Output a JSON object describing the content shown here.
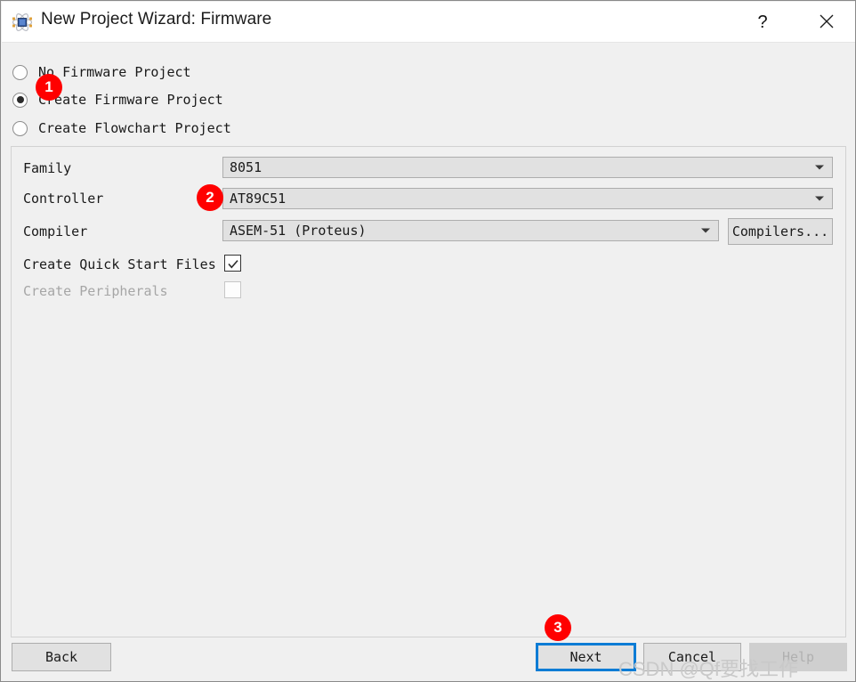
{
  "window": {
    "title": "New Project Wizard: Firmware",
    "icon": "atom-icon",
    "help_button": "?",
    "close_button": "✕"
  },
  "project_type": {
    "options": [
      {
        "label": "No Firmware Project",
        "selected": false
      },
      {
        "label": "Create Firmware Project",
        "selected": true
      },
      {
        "label": "Create Flowchart Project",
        "selected": false
      }
    ]
  },
  "form": {
    "family": {
      "label": "Family",
      "value": "8051"
    },
    "controller": {
      "label": "Controller",
      "value": "AT89C51"
    },
    "compiler": {
      "label": "Compiler",
      "value": "ASEM-51 (Proteus)"
    },
    "compilers_button": "Compilers...",
    "quick_start": {
      "label": "Create Quick Start Files",
      "checked": true
    },
    "peripherals": {
      "label": "Create Peripherals",
      "checked": false,
      "disabled": true
    }
  },
  "footer": {
    "back": "Back",
    "next": "Next",
    "cancel": "Cancel",
    "help": "Help"
  },
  "annotations": {
    "badge1": "1",
    "badge2": "2",
    "badge3": "3"
  },
  "watermark": "CSDN @Qf要找工作",
  "colors": {
    "accent_focus": "#0c7cd5",
    "badge_red": "#ff0000",
    "dialog_bg": "#f0f0f0",
    "field_bg": "#e1e1e1"
  }
}
